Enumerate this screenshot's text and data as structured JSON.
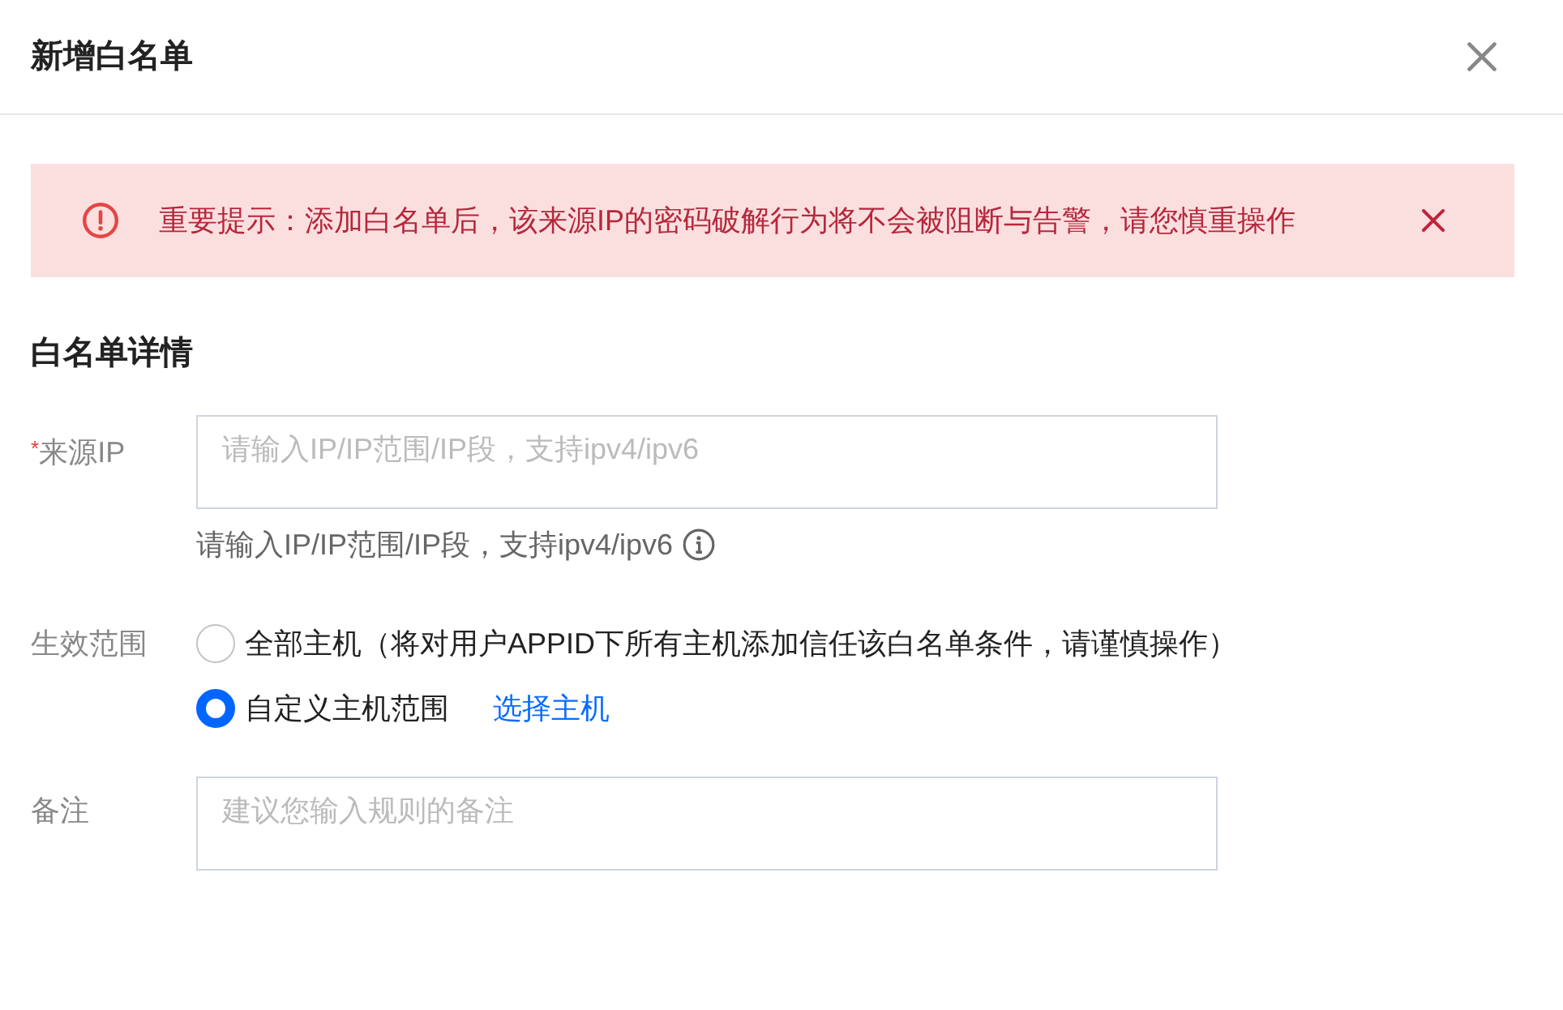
{
  "dialog": {
    "title": "新增白名单"
  },
  "alert": {
    "text": "重要提示：添加白名单后，该来源IP的密码破解行为将不会被阻断与告警，请您慎重操作"
  },
  "section": {
    "title": "白名单详情"
  },
  "fields": [
    {
      "kind": "textarea",
      "required_mark": "*",
      "label": "来源IP",
      "placeholder": "请输入IP/IP范围/IP段，支持ipv4/ipv6",
      "help": "请输入IP/IP范围/IP段，支持ipv4/ipv6"
    },
    {
      "kind": "radio-group",
      "label": "生效范围",
      "options": [
        {
          "label": "全部主机（将对用户APPID下所有主机添加信任该白名单条件，请谨慎操作）",
          "selected": false
        },
        {
          "label": "自定义主机范围",
          "selected": true,
          "link": "选择主机"
        }
      ]
    },
    {
      "kind": "textarea",
      "label": "备注",
      "placeholder": "建议您输入规则的备注"
    }
  ]
}
